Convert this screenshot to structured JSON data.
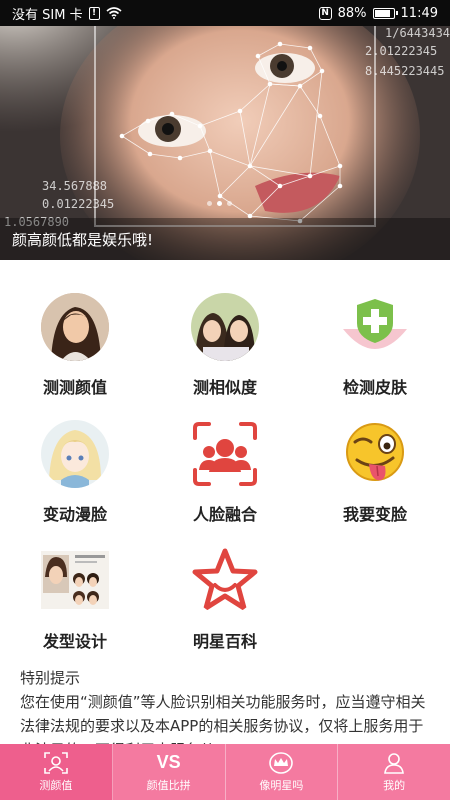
{
  "status_bar": {
    "carrier": "没有 SIM 卡",
    "battery": "88%",
    "battery_level": 0.88,
    "time": "11:49"
  },
  "banner": {
    "caption": "颜高颜低都是娱乐哦!",
    "numbers": [
      "1/6443434",
      "2.01222345",
      "8.445223445",
      "34.567888",
      "0.01222345",
      "1.0567890"
    ],
    "slide_count": 3,
    "active_slide": 2
  },
  "features": [
    {
      "label": "测测颜值",
      "icon": "woman-portrait-icon"
    },
    {
      "label": "测相似度",
      "icon": "two-girls-photo-icon"
    },
    {
      "label": "检测皮肤",
      "icon": "shield-plus-icon"
    },
    {
      "label": "变动漫脸",
      "icon": "anime-girl-icon"
    },
    {
      "label": "人脸融合",
      "icon": "face-scan-icon"
    },
    {
      "label": "我要变脸",
      "icon": "tongue-emoji-icon"
    },
    {
      "label": "发型设计",
      "icon": "hairstyle-catalog-icon"
    },
    {
      "label": "明星百科",
      "icon": "star-icon"
    }
  ],
  "notice": {
    "title": "特别提示",
    "body": "您在使用“测颜值”等人脸识别相关功能服务时，应当遵守相关法律法规的要求以及本APP的相关服务协议，仅将上服务用于非法目的，不得利用本服务从"
  },
  "tabs": [
    {
      "label": "测颜值",
      "icon": "face-frame-icon",
      "active": true
    },
    {
      "label": "颜值比拼",
      "icon": "vs-icon",
      "icon_text": "VS",
      "active": false
    },
    {
      "label": "像明星吗",
      "icon": "crown-icon",
      "active": false
    },
    {
      "label": "我的",
      "icon": "user-icon",
      "active": false
    }
  ],
  "colors": {
    "tab_bg": "#f47aa0",
    "tab_active": "#ee5f8d",
    "accent_red": "#e0453f",
    "shield_green": "#7cc04b"
  }
}
